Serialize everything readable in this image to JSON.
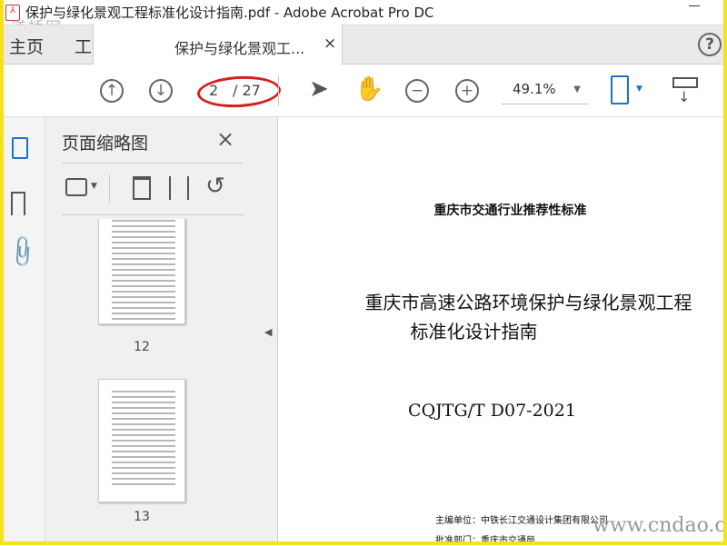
{
  "window": {
    "title": "保护与绿化景观工程标准化设计指南.pdf - Adobe Acrobat Pro DC",
    "watermark": "道桥网"
  },
  "tabs": {
    "home": "主页",
    "tools": "工具",
    "document": "保护与绿化景观工...",
    "close": "×",
    "help": "?"
  },
  "toolbar": {
    "current_page": "2",
    "total_pages": "/ 27",
    "zoom": "49.1%"
  },
  "panel": {
    "title": "页面缩略图",
    "close": "×",
    "thumbnails": [
      {
        "label": "12"
      },
      {
        "label": "13"
      }
    ]
  },
  "document": {
    "header": "重庆市交通行业推荐性标准",
    "title_line1": "重庆市高速公路环境保护与绿化景观工程",
    "title_line2": "标准化设计指南",
    "code": "CQJTG/T D07-2021",
    "editor": "主编单位：中铁长江交通设计集团有限公司",
    "approver": "批准部门：重庆市交通局"
  },
  "overlay_watermark": "www.cndao.com",
  "colors": {
    "accent": "#1a73c8",
    "highlight_oval": "#d3201f",
    "frame": "#f5e21a"
  }
}
